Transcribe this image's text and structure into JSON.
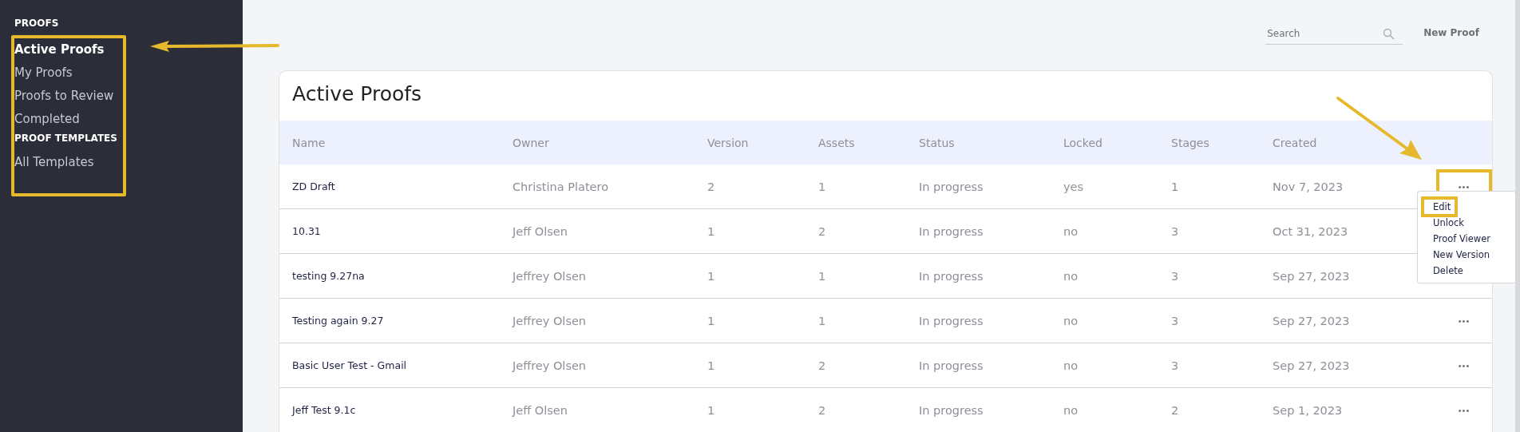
{
  "sidebar": {
    "sections": [
      {
        "heading": "PROOFS",
        "items": [
          {
            "label": "Active Proofs",
            "selected": true
          },
          {
            "label": "My Proofs",
            "selected": false
          },
          {
            "label": "Proofs to Review",
            "selected": false
          },
          {
            "label": "Completed",
            "selected": false
          }
        ]
      },
      {
        "heading": "PROOF TEMPLATES",
        "items": [
          {
            "label": "All Templates",
            "selected": false
          }
        ]
      }
    ],
    "highlighted": true
  },
  "toolbar": {
    "search": {
      "placeholder": "Search"
    },
    "new_button": "New Proof"
  },
  "table": {
    "title": "Active Proofs",
    "columns": [
      "Name",
      "Owner",
      "Version",
      "Assets",
      "Status",
      "Locked",
      "Stages",
      "Created"
    ],
    "rows": [
      {
        "cells": [
          "ZD Draft",
          "Christina Platero",
          "2",
          "1",
          "In progress",
          "yes",
          "1",
          "Nov 7, 2023"
        ],
        "actions": "•••",
        "menu_open": true,
        "highlighted": true
      },
      {
        "cells": [
          "10.31",
          "Jeff Olsen",
          "1",
          "2",
          "In progress",
          "no",
          "3",
          "Oct 31, 2023"
        ],
        "menu_open": false
      },
      {
        "cells": [
          "testing 9.27na",
          "Jeffrey Olsen",
          "1",
          "1",
          "In progress",
          "no",
          "3",
          "Sep 27, 2023"
        ],
        "menu_open": false
      },
      {
        "cells": [
          "Testing again 9.27",
          "Jeffrey Olsen",
          "1",
          "1",
          "In progress",
          "no",
          "3",
          "Sep 27, 2023"
        ],
        "actions": "•••",
        "menu_open": false,
        "highlighted": false
      },
      {
        "cells": [
          "Basic User Test - Gmail",
          "Jeffrey Olsen",
          "1",
          "2",
          "In progress",
          "no",
          "3",
          "Sep 27, 2023"
        ],
        "actions": "•••",
        "menu_open": false,
        "highlighted": false
      },
      {
        "cells": [
          "Jeff Test 9.1c",
          "Jeff Olsen",
          "1",
          "2",
          "In progress",
          "no",
          "2",
          "Sep 1, 2023"
        ],
        "actions": "•••",
        "menu_open": false,
        "highlighted": false
      }
    ],
    "row_menu": [
      {
        "label": "Edit",
        "highlighted": true
      },
      {
        "label": "Unlock",
        "highlighted": false
      },
      {
        "label": "Proof Viewer",
        "highlighted": false
      },
      {
        "label": "New Version",
        "highlighted": false
      },
      {
        "label": "Delete",
        "highlighted": false
      }
    ]
  }
}
